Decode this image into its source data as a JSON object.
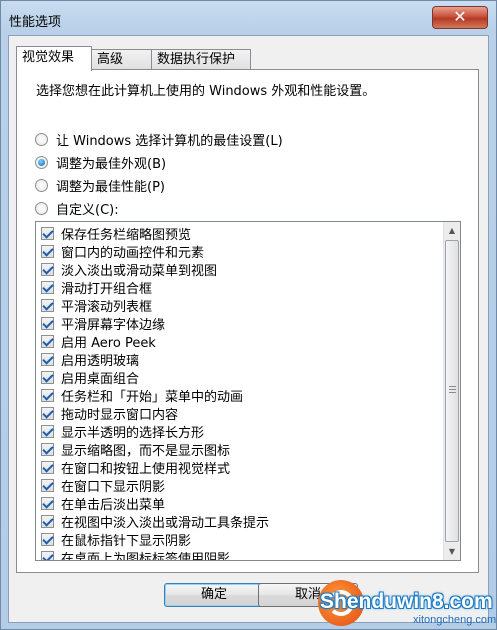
{
  "window": {
    "title": "性能选项",
    "close_symbol": "✕"
  },
  "tabs": [
    {
      "label": "视觉效果",
      "active": true
    },
    {
      "label": "高级",
      "active": false
    },
    {
      "label": "数据执行保护",
      "active": false
    }
  ],
  "visual": {
    "description": "选择您想在此计算机上使用的 Windows 外观和性能设置。",
    "radios": [
      {
        "label": "让 Windows 选择计算机的最佳设置(L)",
        "checked": false
      },
      {
        "label": "调整为最佳外观(B)",
        "checked": true
      },
      {
        "label": "调整为最佳性能(P)",
        "checked": false
      },
      {
        "label": "自定义(C):",
        "checked": false
      }
    ],
    "effects": [
      {
        "label": "保存任务栏缩略图预览",
        "checked": true
      },
      {
        "label": "窗口内的动画控件和元素",
        "checked": true
      },
      {
        "label": "淡入淡出或滑动菜单到视图",
        "checked": true
      },
      {
        "label": "滑动打开组合框",
        "checked": true
      },
      {
        "label": "平滑滚动列表框",
        "checked": true
      },
      {
        "label": "平滑屏幕字体边缘",
        "checked": true
      },
      {
        "label": "启用 Aero Peek",
        "checked": true
      },
      {
        "label": "启用透明玻璃",
        "checked": true
      },
      {
        "label": "启用桌面组合",
        "checked": true
      },
      {
        "label": "任务栏和「开始」菜单中的动画",
        "checked": true
      },
      {
        "label": "拖动时显示窗口内容",
        "checked": true
      },
      {
        "label": "显示半透明的选择长方形",
        "checked": true
      },
      {
        "label": "显示缩略图，而不是显示图标",
        "checked": true
      },
      {
        "label": "在窗口和按钮上使用视觉样式",
        "checked": true
      },
      {
        "label": "在窗口下显示阴影",
        "checked": true
      },
      {
        "label": "在单击后淡出菜单",
        "checked": true
      },
      {
        "label": "在视图中淡入淡出或滑动工具条提示",
        "checked": true
      },
      {
        "label": "在鼠标指针下显示阴影",
        "checked": true
      },
      {
        "label": "在桌面上为图标标签使用阴影",
        "checked": true
      }
    ]
  },
  "buttons": {
    "ok": "确定",
    "cancel": "取消"
  },
  "watermark": {
    "text": "Shenduwin8.com",
    "sub": "xitongcheng.com"
  }
}
